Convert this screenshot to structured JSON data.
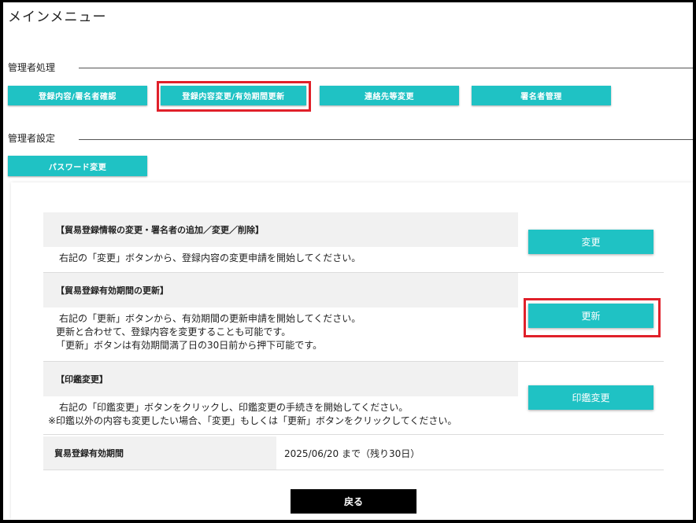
{
  "page": {
    "title": "メインメニュー"
  },
  "admin_processing": {
    "label": "管理者処理",
    "buttons": [
      "登録内容/署名者確認",
      "登録内容変更/有効期間更新",
      "連絡先等変更",
      "署名者管理"
    ]
  },
  "admin_settings": {
    "label": "管理者設定",
    "buttons": [
      "パスワード変更"
    ]
  },
  "sections": {
    "change": {
      "heading": "【貿易登録情報の変更・署名者の追加／変更／削除】",
      "lines": [
        "右記の「変更」ボタンから、登録内容の変更申請を開始してください。"
      ],
      "button": "変更"
    },
    "renew": {
      "heading": "【貿易登録有効期間の更新】",
      "lines": [
        "右記の「更新」ボタンから、有効期間の更新申請を開始してください。",
        "更新と合わせて、登録内容を変更することも可能です。",
        "「更新」ボタンは有効期間満了日の30日前から押下可能です。"
      ],
      "button": "更新"
    },
    "seal": {
      "heading": "【印鑑変更】",
      "lines": [
        "右記の「印鑑変更」ボタンをクリックし、印鑑変更の手続きを開始してください。",
        "※印鑑以外の内容も変更したい場合、「変更」もしくは「更新」ボタンをクリックしてください。"
      ],
      "button": "印鑑変更"
    }
  },
  "validity": {
    "label": "貿易登録有効期間",
    "value": "2025/06/20 まで（残り30日）"
  },
  "back_button": "戻る",
  "colors": {
    "accent": "#1fc2c4",
    "highlight": "#e0202a",
    "back": "#000000"
  }
}
